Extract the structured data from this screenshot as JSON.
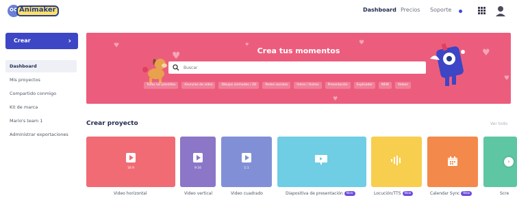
{
  "header": {
    "nav": [
      "Dashboard",
      "Precios",
      "Soporte"
    ]
  },
  "sidebar": {
    "crear_label": "Crear",
    "items": [
      {
        "label": "Dashboard",
        "active": true
      },
      {
        "label": "Mis proyectos"
      },
      {
        "label": "Compartido conmigo"
      },
      {
        "label": "Kit de marca"
      },
      {
        "label": "Mario's team 1"
      },
      {
        "label": "Administrar exportaciones"
      }
    ]
  },
  "hero": {
    "title": "Crea tus momentos",
    "search_placeholder": "Buscar",
    "chips": [
      "Todas las plantillas",
      "Anuncios de video",
      "Dibujos animados / 2D",
      "Redes sociales",
      "Intros / Outros",
      "Presentación",
      "Explicador",
      "NEW",
      "Videos"
    ]
  },
  "section": {
    "title": "Crear proyecto",
    "see_all": "Ver todo"
  },
  "cards": [
    {
      "label": "Video horizontal",
      "ratio": "16:9",
      "color": "#f16b74"
    },
    {
      "label": "Video vertical",
      "ratio": "9:16",
      "color": "#8b76c7"
    },
    {
      "label": "Video cuadrado",
      "ratio": "1:1",
      "color": "#8190d6"
    },
    {
      "label": "Diapositiva de presentación",
      "badge": "New",
      "color": "#6fcde4"
    },
    {
      "label": "Locución/TTS",
      "badge": "New",
      "color": "#f8ce4f"
    },
    {
      "label": "Calendar Sync",
      "badge": "New",
      "color": "#f3894b"
    },
    {
      "label": "Scre",
      "color": "#5fc6a4"
    }
  ],
  "colors": {
    "accent": "#3d46c4",
    "hero": "#ec5d7d",
    "badge": "#6d4ce0"
  }
}
